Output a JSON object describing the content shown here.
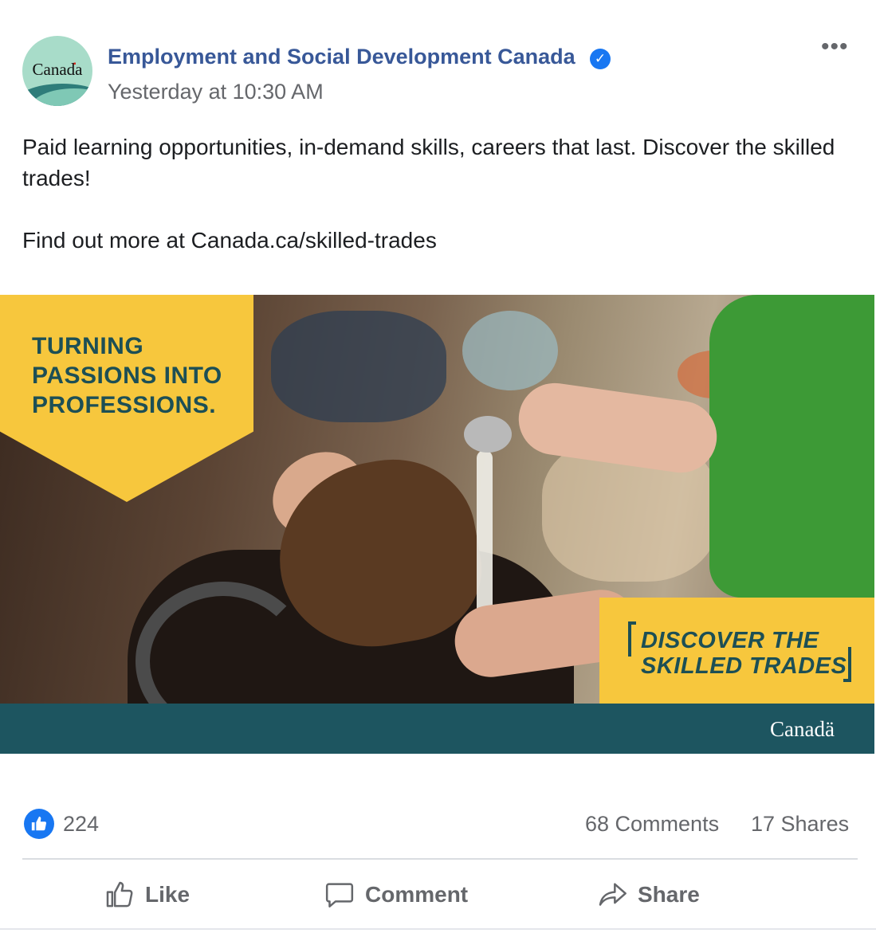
{
  "header": {
    "page_name": "Employment and Social Development Canada",
    "timestamp": "Yesterday at 10:30 AM",
    "avatar_wordmark": "Canada",
    "verified_icon": "verified-check-icon",
    "more_icon": "more-horizontal-icon"
  },
  "post": {
    "line1": "Paid learning opportunities, in-demand skills, careers that last. Discover the skilled trades!",
    "line2": "Find out more at Canada.ca/skilled-trades"
  },
  "image": {
    "banner_top_left": [
      "TURNING",
      "PASSIONS INTO",
      "PROFESSIONS."
    ],
    "banner_bottom_right": [
      "DISCOVER THE",
      "SKILLED TRADES"
    ],
    "footer_wordmark": "Canadä",
    "accent_yellow": "#f7c73d",
    "accent_teal": "#1d5560"
  },
  "reactions": {
    "like_count": "224",
    "comments": "68 Comments",
    "shares": "17 Shares",
    "like_icon": "thumbs-up-icon"
  },
  "actions": {
    "like_label": "Like",
    "comment_label": "Comment",
    "share_label": "Share"
  },
  "colors": {
    "link_blue": "#385898",
    "facebook_blue": "#1877f2",
    "secondary_text": "#65676b"
  }
}
